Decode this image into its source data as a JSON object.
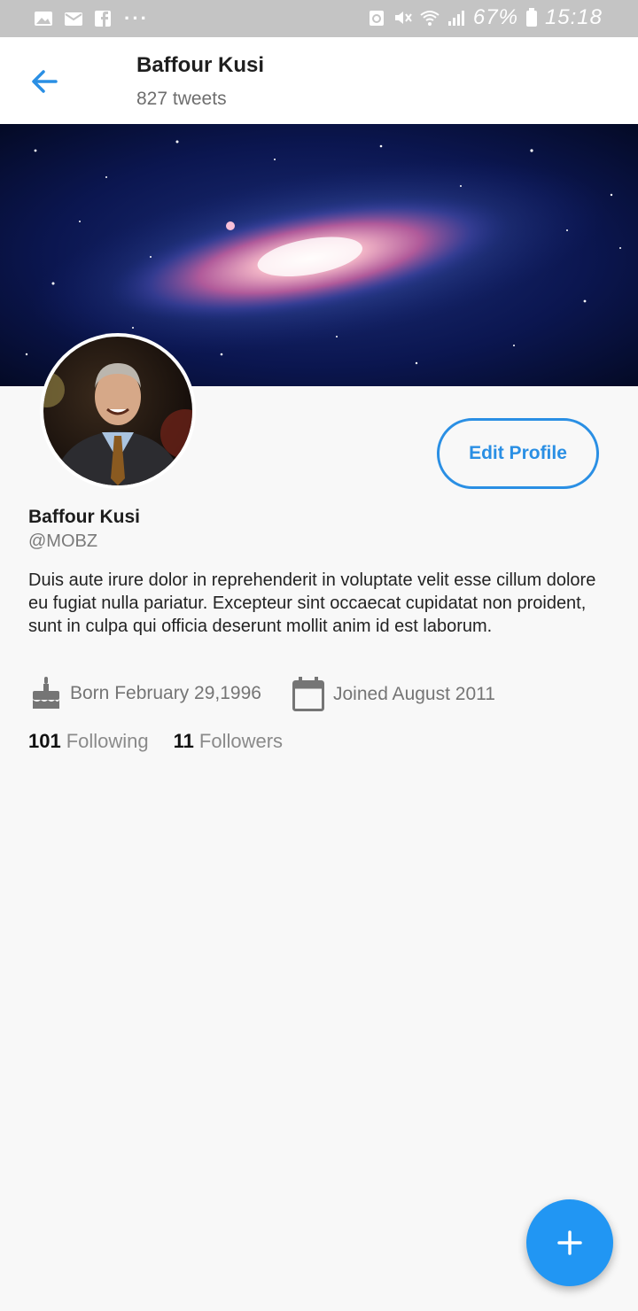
{
  "status_bar": {
    "left_icons": [
      "image-icon",
      "mail-icon",
      "facebook-icon",
      "more-dots-icon"
    ],
    "right_icons": [
      "sync-icon",
      "mute-icon",
      "wifi-icon",
      "signal-icon"
    ],
    "battery_percent": "67%",
    "time": "15:18",
    "dots": "···"
  },
  "header": {
    "title": "Baffour Kusi",
    "tweet_count": "827 tweets",
    "back_icon": "arrow-left-icon"
  },
  "profile": {
    "edit_button_label": "Edit Profile",
    "name": "Baffour Kusi",
    "handle": "@MOBZ",
    "bio": "Duis aute irure dolor in reprehenderit in voluptate velit esse cillum dolore eu fugiat nulla pariatur. Excepteur sint occaecat cupidatat non proident, sunt in culpa qui officia deserunt mollit anim id est laborum.",
    "born": "Born February 29,1996",
    "joined": "Joined August 2011",
    "following_count": "101",
    "following_label": "Following",
    "followers_count": "11",
    "followers_label": "Followers"
  },
  "fab": {
    "icon": "plus-icon"
  },
  "colors": {
    "accent": "#2196f3",
    "status_bar": "#c4c4c4",
    "background": "#f8f8f8"
  }
}
